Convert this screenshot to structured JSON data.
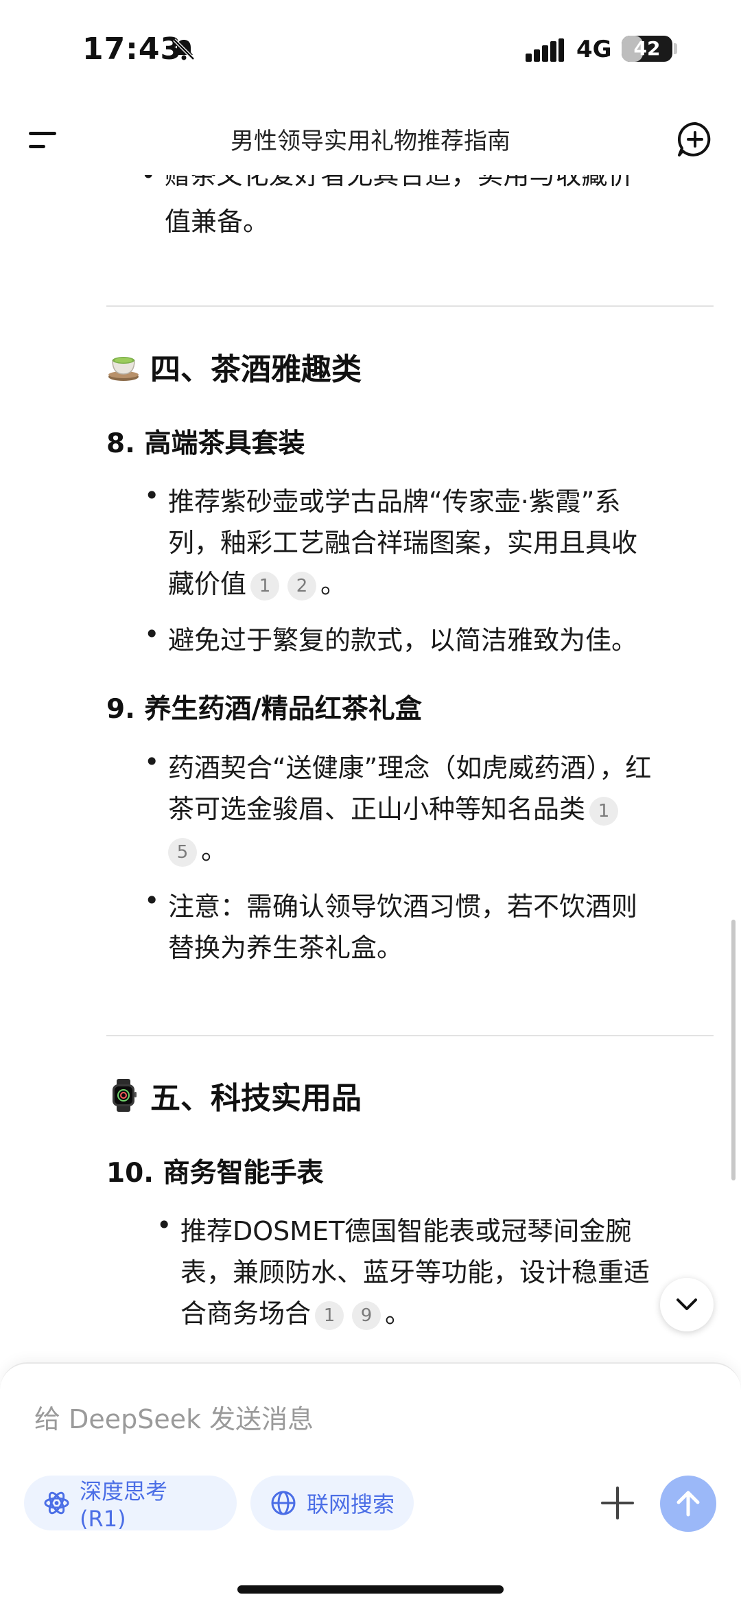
{
  "status_bar": {
    "time": "17:43",
    "network": "4G",
    "battery": "42",
    "battery_level": 0.42,
    "icons": [
      "bell-slash-icon",
      "signal-icon",
      "battery-icon"
    ]
  },
  "header": {
    "title": "男性领导实用礼物推荐指南",
    "icons": [
      "menu-icon",
      "new-chat-icon"
    ]
  },
  "content": {
    "cut_line": "• 赠茶文化爱好者尤其合适，实用与收藏价",
    "prev_tail": "值兼备。",
    "section4": {
      "emoji": "teacup-icon",
      "title": "四、茶酒雅趣类",
      "item8": {
        "title": "8. 高端茶具套装",
        "b1_l1": "推荐紫砂壶或学古品牌“传家壶·紫霞”系",
        "b1_l2": "列，釉彩工艺融合祥瑞图案，实用且具收",
        "b1_l3": "藏价值",
        "b1_cites": [
          "1",
          "2"
        ],
        "b1_end": "。",
        "b2": "避免过于繁复的款式，以简洁雅致为佳。"
      },
      "item9": {
        "title": "9. 养生药酒/精品红茶礼盒",
        "b1_l1": "药酒契合“送健康”理念（如虎威药酒），红",
        "b1_l2": "茶可选金骏眉、正山小种等知名品类",
        "b1_cite_a": "1",
        "b1_cite_b": "5",
        "b1_end": "。",
        "b2_l1": "注意：需确认领导饮酒习惯，若不饮酒则",
        "b2_l2": "替换为养生茶礼盒。"
      }
    },
    "section5": {
      "emoji": "watch-icon",
      "title": "五、科技实用品",
      "item10": {
        "title": "10. 商务智能手表",
        "b1_l1": "推荐DOSMET德国智能表或冠琴间金腕",
        "b1_l2": "表，兼顾防水、蓝牙等功能，设计稳重适",
        "b1_l3": "合商务场合",
        "b1_cites": [
          "1",
          "9"
        ],
        "b1_end": "。"
      }
    },
    "bullet_char": "•"
  },
  "composer": {
    "placeholder": "给 DeepSeek 发送消息",
    "deep_think_label": "深度思考 (R1)",
    "web_search_label": "联网搜索",
    "accent_color": "#4b6ee6",
    "send_color": "#9bb8f8"
  }
}
